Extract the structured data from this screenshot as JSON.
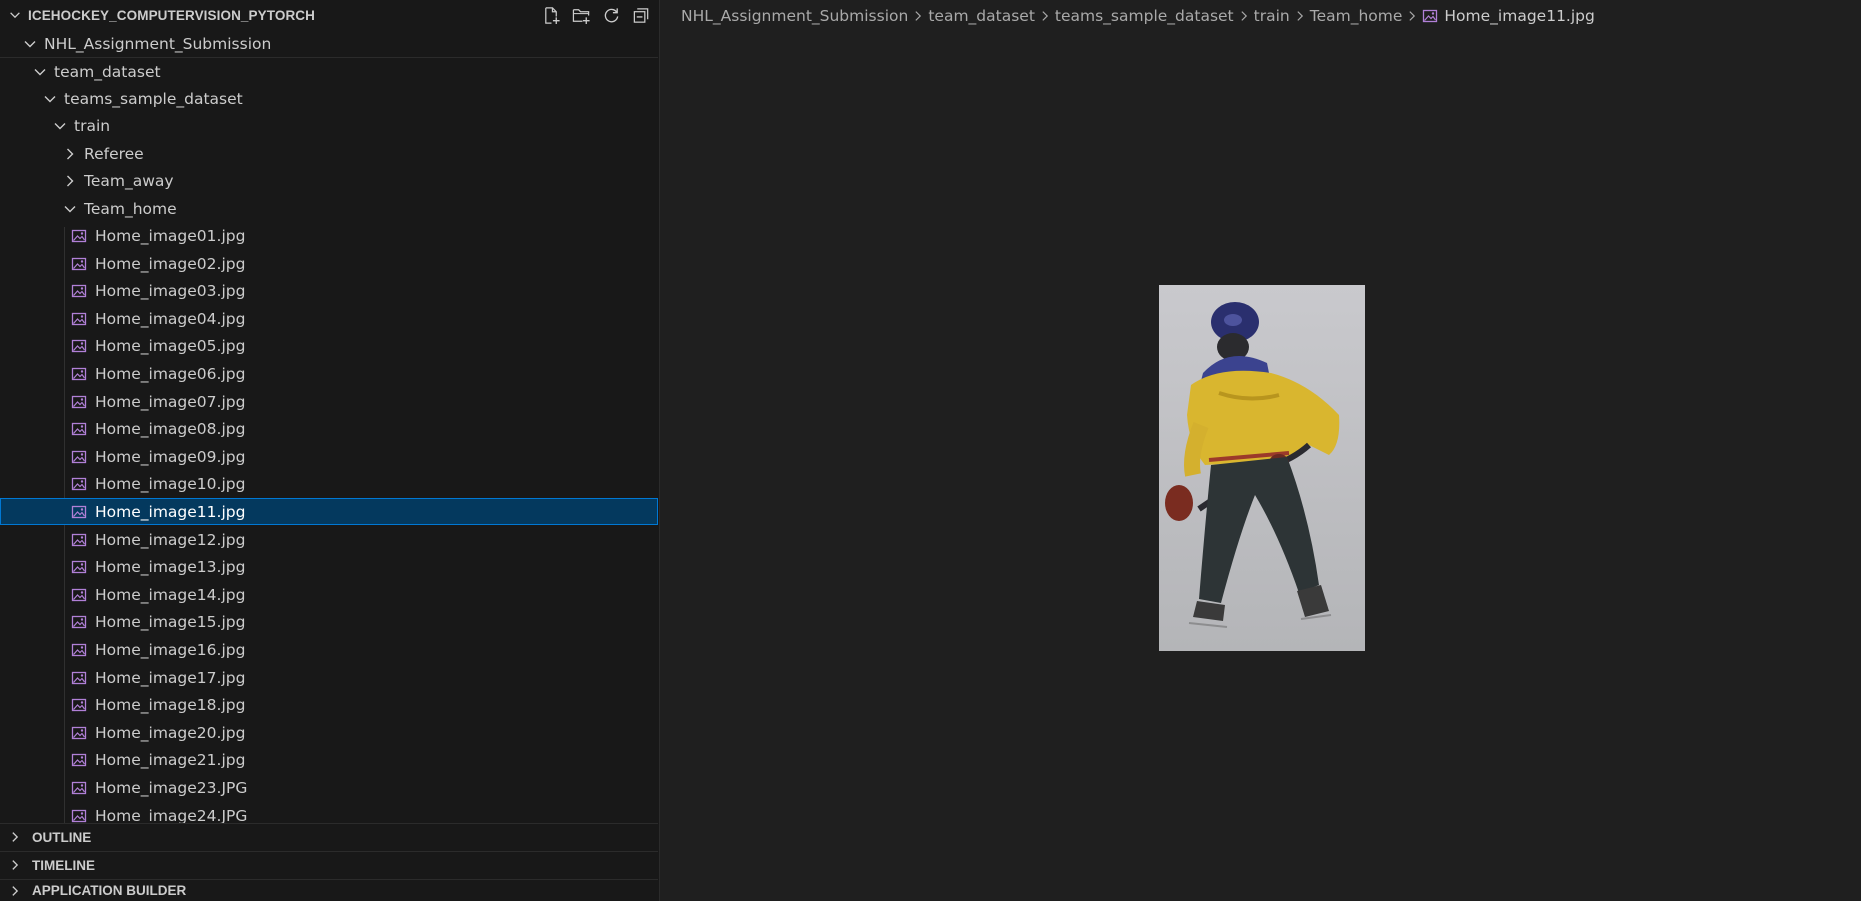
{
  "explorer": {
    "title": "ICEHOCKEY_COMPUTERVISION_PYTORCH",
    "actions": [
      "new-file",
      "new-folder",
      "refresh",
      "collapse-all"
    ]
  },
  "tree": {
    "root": "NHL_Assignment_Submission",
    "team_dataset": "team_dataset",
    "teams_sample_dataset": "teams_sample_dataset",
    "train": "train",
    "referee": "Referee",
    "team_away": "Team_away",
    "team_home": "Team_home",
    "files": [
      "Home_image01.jpg",
      "Home_image02.jpg",
      "Home_image03.jpg",
      "Home_image04.jpg",
      "Home_image05.jpg",
      "Home_image06.jpg",
      "Home_image07.jpg",
      "Home_image08.jpg",
      "Home_image09.jpg",
      "Home_image10.jpg",
      "Home_image11.jpg",
      "Home_image12.jpg",
      "Home_image13.jpg",
      "Home_image14.jpg",
      "Home_image15.jpg",
      "Home_image16.jpg",
      "Home_image17.jpg",
      "Home_image18.jpg",
      "Home_image20.jpg",
      "Home_image21.jpg",
      "Home_image23.JPG",
      "Home_image24.JPG"
    ],
    "selected_file": "Home_image11.jpg"
  },
  "panels": {
    "outline": "OUTLINE",
    "timeline": "TIMELINE",
    "application_builder": "APPLICATION BUILDER"
  },
  "breadcrumb": [
    "NHL_Assignment_Submission",
    "team_dataset",
    "teams_sample_dataset",
    "train",
    "Team_home",
    "Home_image11.jpg"
  ],
  "colors": {
    "sidebar_bg": "#181818",
    "editor_bg": "#1f1f1f",
    "selection_bg": "#04395e",
    "selection_border": "#0078d4",
    "image_icon": "#b180d7"
  }
}
